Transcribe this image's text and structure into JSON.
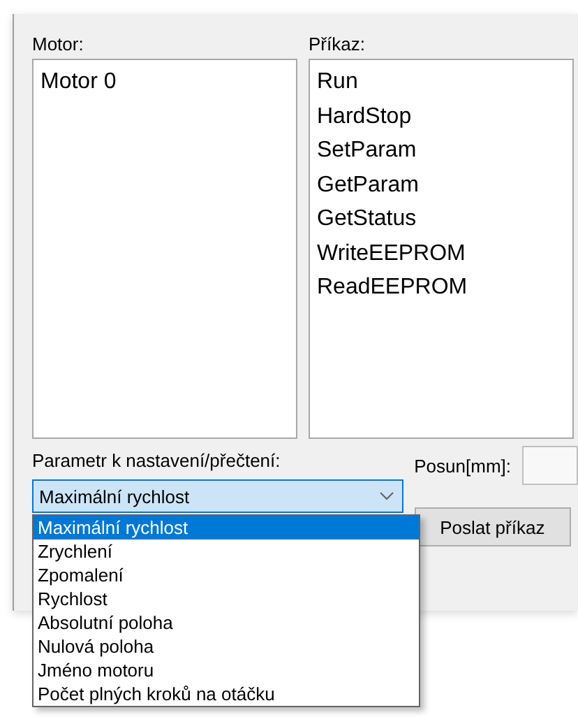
{
  "motor": {
    "label": "Motor:",
    "items": [
      "Motor 0"
    ]
  },
  "command": {
    "label": "Příkaz:",
    "items": [
      "Run",
      "HardStop",
      "SetParam",
      "GetParam",
      "GetStatus",
      "WriteEEPROM",
      "ReadEEPROM"
    ]
  },
  "parameter": {
    "label": "Parametr k nastavení/přečtení:",
    "value": "Maximální rychlost",
    "expanded": true,
    "options": [
      {
        "text": "Maximální rychlost",
        "selected": true
      },
      {
        "text": "Zrychlení",
        "selected": false
      },
      {
        "text": "Zpomalení",
        "selected": false
      },
      {
        "text": "Rychlost",
        "selected": false
      },
      {
        "text": "Absolutní poloha",
        "selected": false
      },
      {
        "text": "Nulová poloha",
        "selected": false
      },
      {
        "text": "Jméno motoru",
        "selected": false
      },
      {
        "text": "Počet plných kroků na otáčku",
        "selected": false
      }
    ]
  },
  "shift": {
    "label": "Posun[mm]:"
  },
  "send_button": "Poslat příkaz"
}
